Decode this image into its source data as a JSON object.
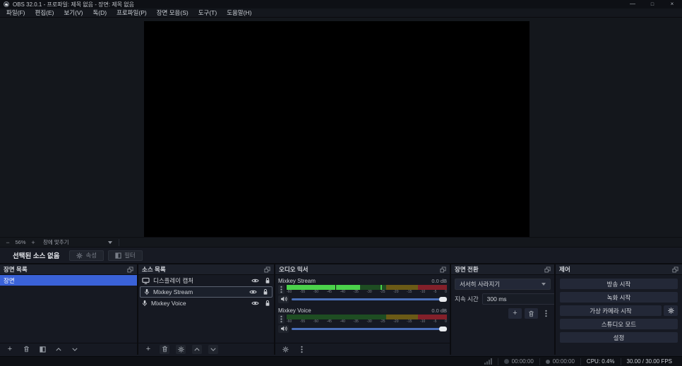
{
  "colors": {
    "accent_blue": "#3a62d8",
    "titlebar_bg": "#0e1015",
    "panel_bg": "#161922",
    "meter_green_bright": "#4bd24b",
    "meter_green_dim": "#1e4d22",
    "meter_yellow_dim": "#6b5a16",
    "meter_red_dim": "#83202a",
    "slider_blue": "#4a6fb8"
  },
  "window": {
    "title": "OBS 32.0.1 - 프로파일: 제목 없음 - 장면: 제목 없음",
    "minimize_glyph": "—",
    "maximize_glyph": "□",
    "close_glyph": "×"
  },
  "menu": {
    "items": [
      "파일(F)",
      "편집(E)",
      "보기(V)",
      "독(D)",
      "프로파일(P)",
      "장면 모음(S)",
      "도구(T)",
      "도움말(H)"
    ]
  },
  "preview": {
    "zoom_out": "−",
    "zoom_value": "56%",
    "zoom_in": "+",
    "fit_label": "창에 맞추기"
  },
  "selection_bar": {
    "message": "선택된 소스 없음",
    "properties_label": "속성",
    "filters_label": "필터"
  },
  "scenes_panel": {
    "title": "장면 목록",
    "items": [
      {
        "label": "장면"
      }
    ]
  },
  "sources_panel": {
    "title": "소스 목록",
    "items": [
      {
        "label": "디스플레이 캡처",
        "icon": "display-icon"
      },
      {
        "label": "Mixkey Stream",
        "icon": "mic-icon"
      },
      {
        "label": "Mixkey Voice",
        "icon": "mic-icon"
      }
    ]
  },
  "mixer_panel": {
    "title": "오디오 믹서",
    "scale": [
      "-60",
      "-55",
      "-50",
      "-45",
      "-40",
      "-35",
      "-30",
      "-25",
      "-20",
      "-15",
      "-10",
      "-5",
      "0"
    ],
    "channels": [
      {
        "name": "Mixkey Stream",
        "db": "0.0 dB"
      },
      {
        "name": "Mixkey Voice",
        "db": "0.0 dB"
      }
    ]
  },
  "transitions_panel": {
    "title": "장면 전환",
    "selected_transition": "서서히 사라지기",
    "duration_label": "지속 시간",
    "duration_value": "300 ms"
  },
  "controls_panel": {
    "title": "제어",
    "stream_button": "방송 시작",
    "record_button": "녹화 시작",
    "vcam_button": "가상 카메라 시작",
    "studio_button": "스튜디오 모드",
    "settings_button": "설정"
  },
  "status_bar": {
    "stream_time": "00:00:00",
    "record_time": "00:00:00",
    "cpu": "CPU: 0.4%",
    "fps": "30.00 / 30.00 FPS"
  }
}
